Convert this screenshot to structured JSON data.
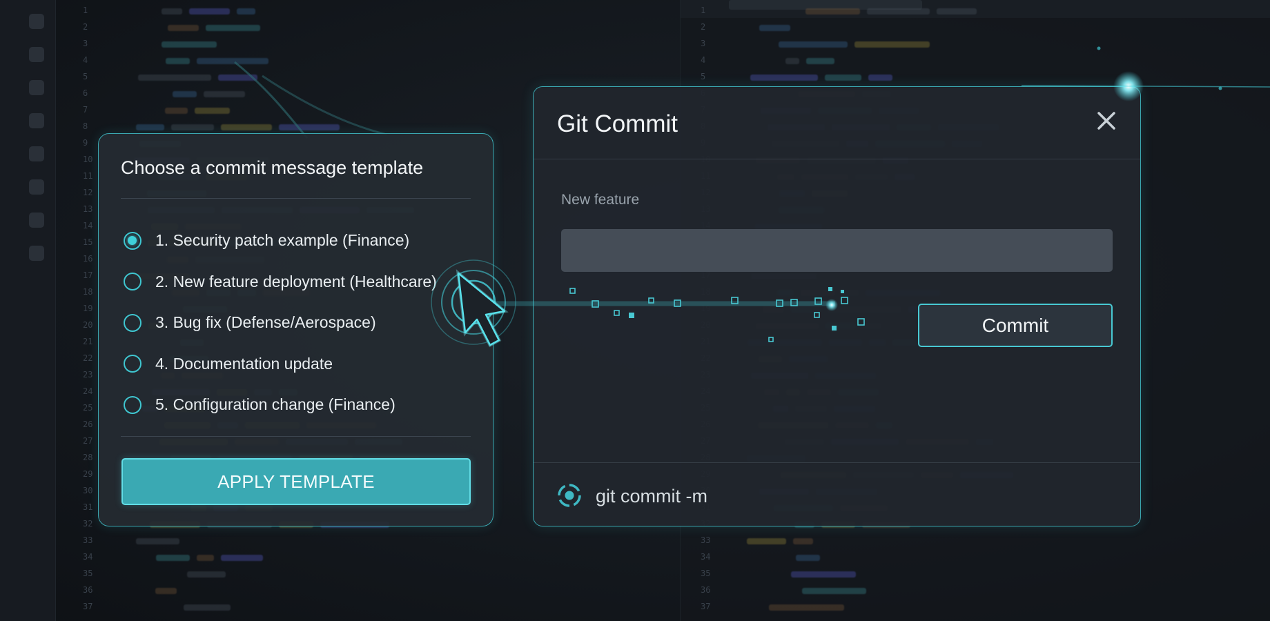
{
  "template_panel": {
    "title": "Choose a commit message template",
    "options": [
      {
        "label": "1. Security patch example (Finance)",
        "selected": true
      },
      {
        "label": "2. New feature deployment (Healthcare)",
        "selected": false
      },
      {
        "label": "3. Bug fix (Defense/Aerospace)",
        "selected": false
      },
      {
        "label": "4. Documentation update",
        "selected": false
      },
      {
        "label": "5. Configuration change (Finance)",
        "selected": false
      }
    ],
    "apply_label": "APPLY TEMPLATE"
  },
  "commit_dialog": {
    "title": "Git Commit",
    "field_label": "New feature",
    "message_value": "",
    "commit_label": "Commit",
    "footer_command": "git commit -m"
  },
  "icons": {
    "close": "close-icon",
    "cursor": "mouse-pointer-icon",
    "footer": "git-icon"
  },
  "colors": {
    "accent": "#3fc6d0",
    "apply_fill": "#3aa9b3",
    "panel_bg": "#252b32",
    "dialog_bg": "#21262d",
    "background": "#13171d"
  }
}
